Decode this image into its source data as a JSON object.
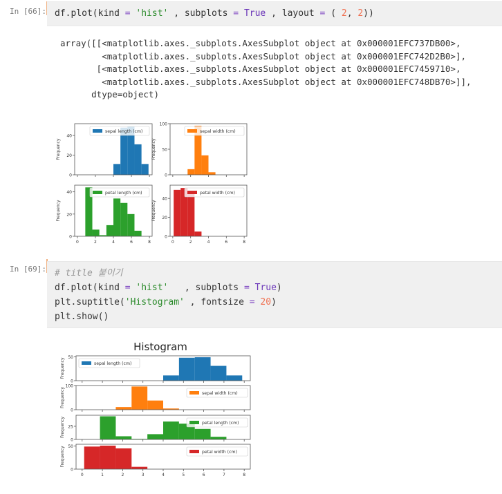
{
  "cells": [
    {
      "prompt": "In [66]:",
      "code": [
        [
          [
            "df.plot(kind ",
            "t"
          ],
          [
            "=",
            "op"
          ],
          [
            " ",
            "t"
          ],
          [
            "'hist'",
            "str"
          ],
          [
            " , subplots ",
            "t"
          ],
          [
            "=",
            "op"
          ],
          [
            " ",
            "t"
          ],
          [
            "True",
            "kw"
          ],
          [
            " , layout ",
            "t"
          ],
          [
            "=",
            "op"
          ],
          [
            " ( ",
            "t"
          ],
          [
            "2",
            "num"
          ],
          [
            ", ",
            "t"
          ],
          [
            "2",
            "num"
          ],
          [
            "))",
            "t"
          ]
        ]
      ],
      "output": [
        "array([[<matplotlib.axes._subplots.AxesSubplot object at 0x000001EFC737DB00>,",
        "        <matplotlib.axes._subplots.AxesSubplot object at 0x000001EFC742D2B0>],",
        "       [<matplotlib.axes._subplots.AxesSubplot object at 0x000001EFC7459710>,",
        "        <matplotlib.axes._subplots.AxesSubplot object at 0x000001EFC748DB70>]],",
        "      dtype=object)"
      ]
    },
    {
      "prompt": "In [69]:",
      "code": [
        [
          [
            "# title 붙이기",
            "com"
          ]
        ],
        [
          [
            "df.plot(kind ",
            "t"
          ],
          [
            "=",
            "op"
          ],
          [
            " ",
            "t"
          ],
          [
            "'hist'",
            "str"
          ],
          [
            "   , subplots ",
            "t"
          ],
          [
            "=",
            "op"
          ],
          [
            " ",
            "t"
          ],
          [
            "True",
            "kw"
          ],
          [
            ")",
            "t"
          ]
        ],
        [
          [
            "plt.suptitle(",
            "t"
          ],
          [
            "'Histogram'",
            "str"
          ],
          [
            " , fontsize ",
            "t"
          ],
          [
            "=",
            "op"
          ],
          [
            " ",
            "t"
          ],
          [
            "20",
            "num"
          ],
          [
            ")",
            "t"
          ]
        ],
        [
          [
            "plt.show()",
            "t"
          ]
        ]
      ]
    }
  ],
  "chart_data": [
    {
      "type": "bar",
      "layout": "2x2",
      "title": "",
      "bin_edges": [
        0.1,
        0.88,
        1.66,
        2.44,
        3.22,
        4.0,
        4.78,
        5.56,
        6.34,
        7.12,
        7.9
      ],
      "xlim": [
        -0.3,
        8.3
      ],
      "xticks": [
        0,
        2,
        4,
        6,
        8
      ],
      "ylabel": "Frequency",
      "series": [
        {
          "name": "sepal length (cm)",
          "color": "#1f77b4",
          "values": [
            0,
            0,
            0,
            0,
            0,
            11,
            48,
            49,
            31,
            11
          ],
          "ylim": [
            0,
            52
          ],
          "yticks": [
            0,
            20,
            40
          ],
          "legend": "top-right"
        },
        {
          "name": "sepal width (cm)",
          "color": "#ff7f0e",
          "values": [
            0,
            0,
            11,
            96,
            38,
            5,
            0,
            0,
            0,
            0
          ],
          "ylim": [
            0,
            100
          ],
          "yticks": [
            0,
            50,
            100
          ],
          "legend": "top-right"
        },
        {
          "name": "petal length (cm)",
          "color": "#2ca02c",
          "values": [
            0,
            44,
            6,
            1,
            10,
            34,
            30,
            20,
            5,
            0
          ],
          "ylim": [
            0,
            46
          ],
          "yticks": [
            0,
            20,
            40
          ],
          "legend": "top-right"
        },
        {
          "name": "petal width (cm)",
          "color": "#d62728",
          "values": [
            49,
            51,
            45,
            5,
            0,
            0,
            0,
            0,
            0,
            0
          ],
          "ylim": [
            0,
            54
          ],
          "yticks": [
            0,
            20,
            40
          ],
          "legend": "top-right"
        }
      ]
    },
    {
      "type": "bar",
      "layout": "4x1",
      "title": "Histogram",
      "bin_edges": [
        0.1,
        0.88,
        1.66,
        2.44,
        3.22,
        4.0,
        4.78,
        5.56,
        6.34,
        7.12,
        7.9
      ],
      "xlim": [
        -0.3,
        8.3
      ],
      "xticks": [
        0,
        1,
        2,
        3,
        4,
        5,
        6,
        7,
        8
      ],
      "ylabel": "Frequency",
      "series": [
        {
          "name": "sepal length (cm)",
          "color": "#1f77b4",
          "values": [
            0,
            0,
            0,
            0,
            0,
            11,
            48,
            49,
            31,
            11
          ],
          "ylim": [
            0,
            52
          ],
          "yticks": [
            0,
            50
          ],
          "legend": "top-left"
        },
        {
          "name": "sepal width (cm)",
          "color": "#ff7f0e",
          "values": [
            0,
            0,
            11,
            96,
            38,
            5,
            0,
            0,
            0,
            0
          ],
          "ylim": [
            0,
            100
          ],
          "yticks": [
            0,
            100
          ],
          "legend": "top-right"
        },
        {
          "name": "petal length (cm)",
          "color": "#2ca02c",
          "values": [
            0,
            44,
            6,
            1,
            10,
            34,
            30,
            20,
            5,
            0
          ],
          "ylim": [
            0,
            46
          ],
          "yticks": [
            0,
            25
          ],
          "legend": "top-right"
        },
        {
          "name": "petal width (cm)",
          "color": "#d62728",
          "values": [
            49,
            51,
            45,
            5,
            0,
            0,
            0,
            0,
            0,
            0
          ],
          "ylim": [
            0,
            54
          ],
          "yticks": [
            0,
            50
          ],
          "legend": "top-right"
        }
      ]
    }
  ]
}
